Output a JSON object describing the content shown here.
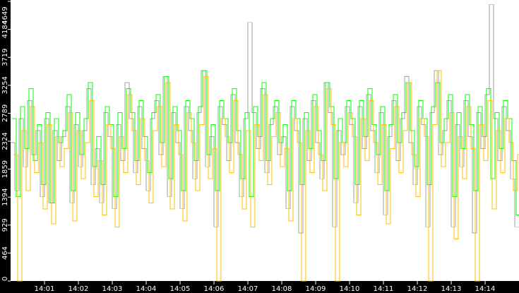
{
  "chart_data": {
    "type": "line",
    "title": "",
    "xlabel": "",
    "ylabel": "",
    "ylim": [
      0,
      4649
    ],
    "xlim_seconds": [
      0,
      900
    ],
    "grid": false,
    "legend": "none",
    "y_ticks": [
      "0",
      "464",
      "929",
      "1394",
      "1859",
      "2324",
      "2789",
      "3254",
      "3719",
      "4184",
      "4649"
    ],
    "x_ticks": [
      {
        "label": "14:01",
        "t": 60
      },
      {
        "label": "14:02",
        "t": 120
      },
      {
        "label": "14:03",
        "t": 180
      },
      {
        "label": "14:04",
        "t": 240
      },
      {
        "label": "14:05",
        "t": 300
      },
      {
        "label": "14:06",
        "t": 360
      },
      {
        "label": "14:07",
        "t": 420
      },
      {
        "label": "14:08",
        "t": 480
      },
      {
        "label": "14:09",
        "t": 540
      },
      {
        "label": "14:10",
        "t": 600
      },
      {
        "label": "14:11",
        "t": 660
      },
      {
        "label": "14:12",
        "t": 720
      },
      {
        "label": "14:13",
        "t": 780
      },
      {
        "label": "14:14",
        "t": 840
      }
    ],
    "sample_interval_seconds": 7.5,
    "series": [
      {
        "name": "grey",
        "color": "#a0a0a0",
        "values": [
          2300,
          1500,
          2700,
          1900,
          3000,
          2100,
          2500,
          1400,
          2700,
          1300,
          2500,
          2000,
          2400,
          2900,
          1300,
          2600,
          1900,
          2500,
          3200,
          1600,
          2200,
          1300,
          2800,
          2400,
          1200,
          2600,
          2000,
          3300,
          2700,
          1800,
          2900,
          2200,
          1500,
          2700,
          3000,
          2100,
          3400,
          1400,
          2800,
          2300,
          1200,
          2900,
          2500,
          1700,
          2800,
          3500,
          1900,
          2400,
          900,
          2900,
          2600,
          2000,
          3100,
          2300,
          1400,
          2700,
          4300,
          2800,
          2200,
          3200,
          1800,
          2600,
          2900,
          2100,
          2400,
          1200,
          2900,
          2500,
          800,
          2700,
          2000,
          3000,
          2300,
          1700,
          3300,
          2800,
          900,
          2500,
          2100,
          2900,
          2600,
          1300,
          2900,
          2200,
          3100,
          2500,
          1800,
          2800,
          1100,
          2400,
          3000,
          2000,
          2700,
          3400,
          2300,
          1600,
          2900,
          2600,
          900,
          2800,
          3500,
          2100,
          2500,
          3000,
          900,
          2600,
          1900,
          3000,
          2400,
          800,
          2800,
          2200,
          3100,
          4600,
          2700,
          2000,
          2900,
          2500,
          1700,
          900
        ]
      },
      {
        "name": "green",
        "color": "#00ff00",
        "values": [
          2700,
          1400,
          2900,
          2200,
          3200,
          2000,
          2600,
          1600,
          2800,
          1300,
          2700,
          2300,
          2500,
          3100,
          1500,
          2800,
          2100,
          2700,
          3300,
          1900,
          2400,
          1600,
          2900,
          2600,
          1400,
          2800,
          2200,
          3200,
          2800,
          2000,
          3000,
          2400,
          1800,
          2800,
          3100,
          2300,
          3400,
          1700,
          2900,
          2500,
          1500,
          3000,
          2700,
          2000,
          2900,
          3500,
          2100,
          2600,
          1500,
          3000,
          2700,
          2300,
          3200,
          2500,
          1700,
          2800,
          1400,
          2900,
          2400,
          3300,
          2000,
          2700,
          3000,
          2300,
          2600,
          1500,
          3000,
          2700,
          1600,
          2800,
          2200,
          3100,
          2500,
          2000,
          3300,
          2900,
          1700,
          2700,
          2300,
          3000,
          2700,
          1600,
          3000,
          2400,
          3200,
          2600,
          2100,
          2900,
          1500,
          2600,
          3100,
          2300,
          2800,
          3300,
          2500,
          1900,
          3000,
          2700,
          1600,
          2900,
          3300,
          2300,
          2700,
          3100,
          1400,
          2800,
          2200,
          3100,
          2600,
          1500,
          2900,
          2400,
          3200,
          1700,
          2800,
          2200,
          3000,
          2700,
          2000,
          1100
        ]
      },
      {
        "name": "orange",
        "color": "#ffc000",
        "values": [
          2100,
          0,
          2500,
          1500,
          2900,
          1800,
          2300,
          1200,
          2600,
          950,
          2400,
          1900,
          2200,
          2800,
          1000,
          2500,
          1700,
          2300,
          3000,
          1400,
          2000,
          1100,
          2600,
          2200,
          900,
          2400,
          1800,
          3100,
          2500,
          1600,
          2700,
          2000,
          1300,
          2500,
          2900,
          1900,
          3300,
          1200,
          2600,
          2100,
          1000,
          2800,
          2300,
          1500,
          2600,
          3400,
          1700,
          2200,
          0,
          2700,
          2400,
          1800,
          3000,
          2100,
          1200,
          2500,
          900,
          2600,
          2000,
          3100,
          1600,
          2400,
          2800,
          1900,
          2200,
          1000,
          2700,
          2300,
          0,
          2500,
          1800,
          2900,
          2100,
          1500,
          3200,
          2600,
          0,
          2300,
          1900,
          2800,
          2400,
          1100,
          2700,
          2000,
          3000,
          2300,
          1600,
          2600,
          950,
          2200,
          2900,
          1800,
          2500,
          3300,
          2100,
          1400,
          2700,
          2400,
          0,
          2600,
          3500,
          1900,
          2300,
          2800,
          700,
          2400,
          1700,
          2900,
          2200,
          0,
          2600,
          2000,
          3000,
          1200,
          2500,
          1800,
          2700,
          2300,
          1500,
          2100
        ]
      }
    ]
  }
}
